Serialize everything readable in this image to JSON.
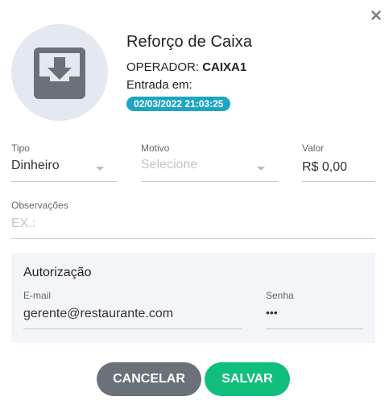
{
  "dialog": {
    "title": "Reforço de Caixa",
    "close_icon": "close-icon",
    "hero_icon": "inbox-download-icon",
    "operator_label": "OPERADOR: ",
    "operator_name": "CAIXA1",
    "entrada_label": "Entrada em:",
    "entrada_datetime": "02/03/2022 21:03:25",
    "badge_color": "#1ea5c3"
  },
  "form": {
    "tipo": {
      "label": "Tipo",
      "value": "Dinheiro"
    },
    "motivo": {
      "label": "Motivo",
      "placeholder": "Selecione"
    },
    "valor": {
      "label": "Valor",
      "value": "R$ 0,00"
    },
    "observacoes": {
      "label": "Observações",
      "placeholder": "EX.:"
    }
  },
  "authorization": {
    "title": "Autorização",
    "email": {
      "label": "E-mail",
      "value": "gerente@restaurante.com"
    },
    "senha": {
      "label": "Senha",
      "value": "•••"
    }
  },
  "actions": {
    "cancel_label": "CANCELAR",
    "save_label": "SALVAR",
    "cancel_color": "#6b7178",
    "save_color": "#10bf7c"
  }
}
